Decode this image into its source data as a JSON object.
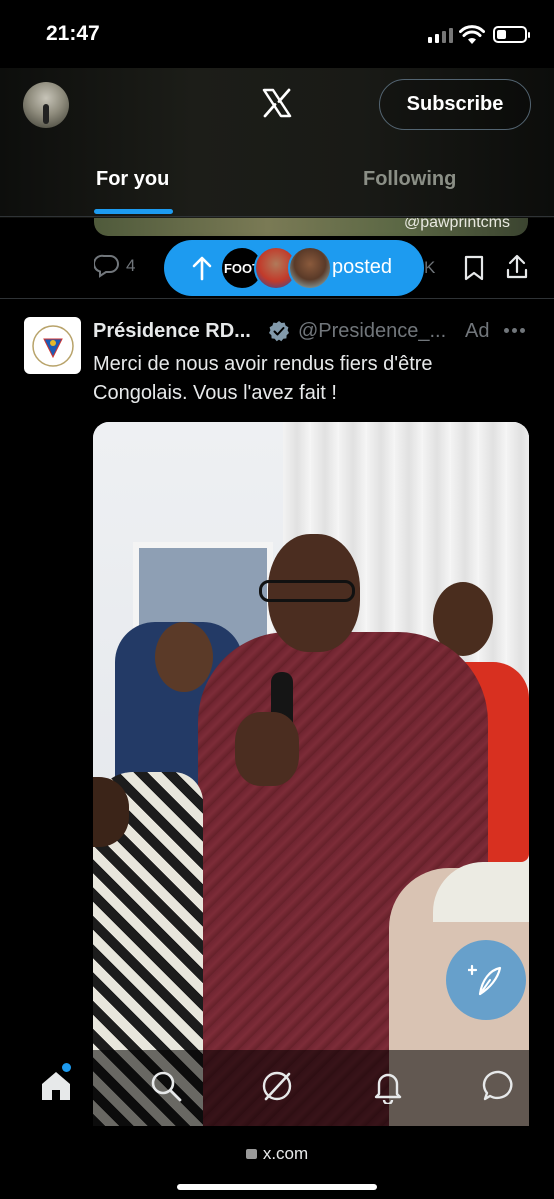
{
  "status_bar": {
    "time": "21:47"
  },
  "header": {
    "subscribe_label": "Subscribe",
    "tabs": [
      {
        "label": "For you",
        "active": true
      },
      {
        "label": "Following",
        "active": false
      }
    ]
  },
  "previous_post": {
    "media_handle": "@pawprintcms",
    "reply_count": "4",
    "views_partial": "K"
  },
  "new_posts_pill": {
    "label": "posted",
    "avatar_text": "FOOT"
  },
  "ad_post": {
    "display_name": "Présidence RD...",
    "handle": "@Presidence_...",
    "ad_label": "Ad",
    "text": "Merci de nous avoir rendus fiers d'être Congolais. Vous l'avez fait !"
  },
  "bottom_nav": {
    "items": [
      "home-icon",
      "search-icon",
      "grok-icon",
      "notifications-icon",
      "messages-icon"
    ]
  },
  "browser": {
    "url": "x.com"
  },
  "colors": {
    "accent": "#1d9bf0",
    "background": "#000000",
    "text_secondary": "#71767b"
  }
}
